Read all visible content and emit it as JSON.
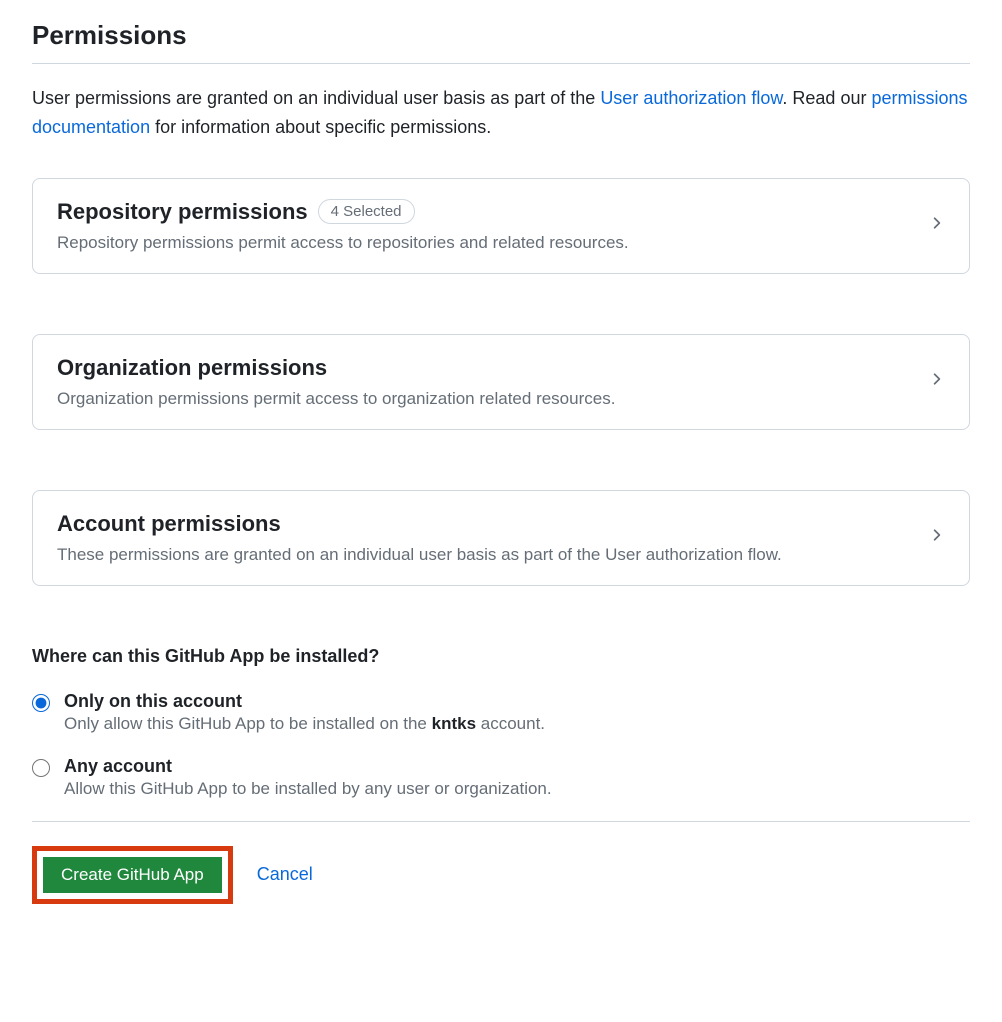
{
  "section_title": "Permissions",
  "intro": {
    "text_before_link1": "User permissions are granted on an individual user basis as part of the ",
    "link1": "User authorization flow",
    "text_after_link1": ". Read our ",
    "link2": "permissions documentation",
    "text_after_link2": " for information about specific permissions."
  },
  "cards": {
    "repository": {
      "title": "Repository permissions",
      "badge": "4 Selected",
      "desc": "Repository permissions permit access to repositories and related resources."
    },
    "organization": {
      "title": "Organization permissions",
      "desc": "Organization permissions permit access to organization related resources."
    },
    "account": {
      "title": "Account permissions",
      "desc": "These permissions are granted on an individual user basis as part of the User authorization flow."
    }
  },
  "install": {
    "title": "Where can this GitHub App be installed?",
    "options": {
      "only": {
        "label": "Only on this account",
        "desc_before": "Only allow this GitHub App to be installed on the ",
        "desc_strong": "kntks",
        "desc_after": " account."
      },
      "any": {
        "label": "Any account",
        "desc": "Allow this GitHub App to be installed by any user or organization."
      }
    }
  },
  "actions": {
    "create": "Create GitHub App",
    "cancel": "Cancel"
  }
}
